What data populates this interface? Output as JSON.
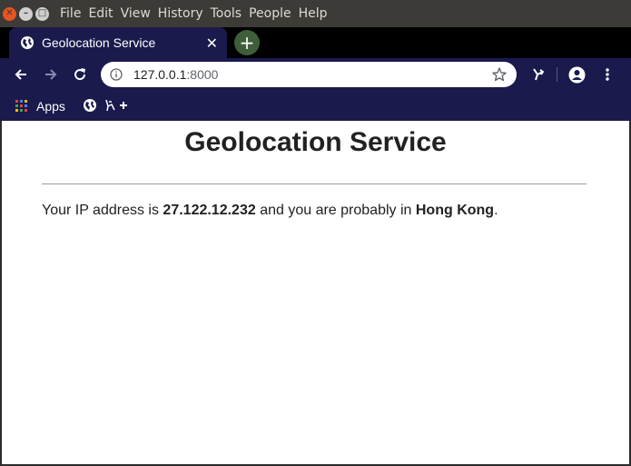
{
  "menubar": {
    "items": [
      "File",
      "Edit",
      "View",
      "History",
      "Tools",
      "People",
      "Help"
    ]
  },
  "tab": {
    "title": "Geolocation Service",
    "close_glyph": "✕",
    "favicon": "globe-icon"
  },
  "newtab": {
    "glyph": "+"
  },
  "toolbar": {
    "url_host": "127.0.0.1",
    "url_port": ":8000"
  },
  "bookmarks": {
    "apps_label": "Apps"
  },
  "page": {
    "title": "Geolocation Service",
    "text_prefix": "Your IP address is ",
    "ip": "27.122.12.232",
    "text_middle": " and you are probably in ",
    "location": "Hong Kong",
    "text_suffix": "."
  },
  "colors": {
    "menubar_bg": "#3c3b37",
    "toolbar_bg": "#1a1a4d",
    "close_button": "#e95420",
    "newtab_bg": "#3e5e3a"
  }
}
